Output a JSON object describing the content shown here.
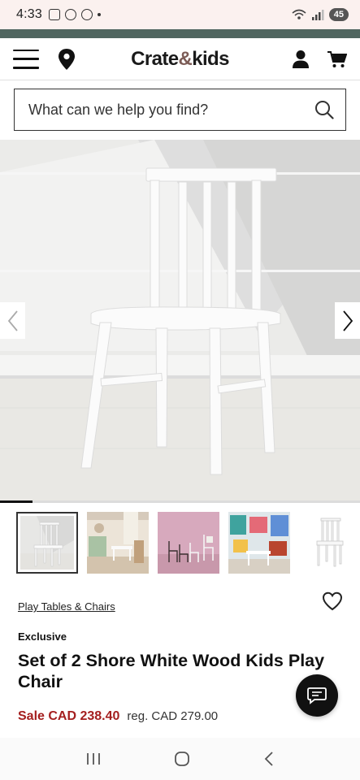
{
  "status_bar": {
    "time": "4:33",
    "battery": "45"
  },
  "header": {
    "logo_main": "Crate",
    "logo_amp": "&",
    "logo_end": "kids",
    "icons": [
      "menu-icon",
      "location-pin-icon",
      "account-icon",
      "cart-icon"
    ]
  },
  "search": {
    "placeholder": "What can we help you find?"
  },
  "gallery": {
    "progress": 0.09,
    "thumbnails": [
      "White chair front view",
      "Chairs in playroom",
      "Chairs on pink backdrop",
      "Chairs with art supplies",
      "Chair angle view"
    ]
  },
  "product": {
    "category_link": "Play Tables & Chairs",
    "badge": "Exclusive",
    "title": "Set of 2 Shore White Wood Kids Play Chair",
    "sale_price": "Sale CAD 238.40",
    "regular_price": "reg. CAD 279.00"
  },
  "colors": {
    "accent_strip": "#506660",
    "sale_red": "#a41f1f",
    "logo_amp": "#7c5c56"
  }
}
